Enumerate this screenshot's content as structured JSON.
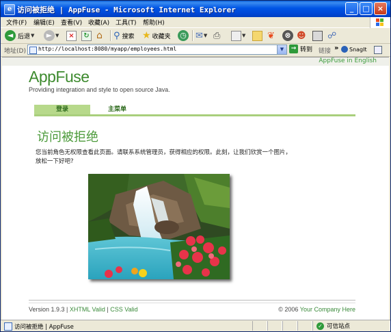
{
  "window": {
    "title": "访问被拒绝 | AppFuse - Microsoft Internet Explorer",
    "min_label": "_",
    "max_label": "□",
    "close_label": "×"
  },
  "menu": [
    "文件(F)",
    "编辑(E)",
    "查看(V)",
    "收藏(A)",
    "工具(T)",
    "帮助(H)"
  ],
  "toolbar": {
    "back_label": "后退",
    "search_label": "搜索",
    "favorites_label": "收藏夹"
  },
  "address": {
    "label": "地址(D)",
    "url": "http://localhost:8080/myapp/employees.html",
    "go_label": "转到",
    "links_label": "链接",
    "snagit_label": "SnagIt"
  },
  "page": {
    "language_link": "AppFuse in English",
    "logo": "AppFuse",
    "tagline": "Providing integration and style to open source Java.",
    "nav": {
      "active_tab": "登录",
      "tab2": "主菜单"
    },
    "heading": "访问被拒绝",
    "message_line1": "您当前角色无权限查看此页面。请联系系统管理员，获得相应的权限。此刻，让我们欣赏一个图片，",
    "message_line2": "放松一下好吧?",
    "footer": {
      "version": "Version 1.9.3",
      "sep1": " | ",
      "xhtml": "XHTML Valid",
      "sep2": " | ",
      "css": "CSS Valid",
      "copyright": "© 2006 ",
      "company": "Your Company Here"
    }
  },
  "status": {
    "text": "访问被拒绝 | AppFuse",
    "zone": "可信站点"
  },
  "colors": {
    "brand_green": "#3d8a2e",
    "nav_green": "#b7d98b",
    "titlebar_blue": "#0055e5"
  }
}
